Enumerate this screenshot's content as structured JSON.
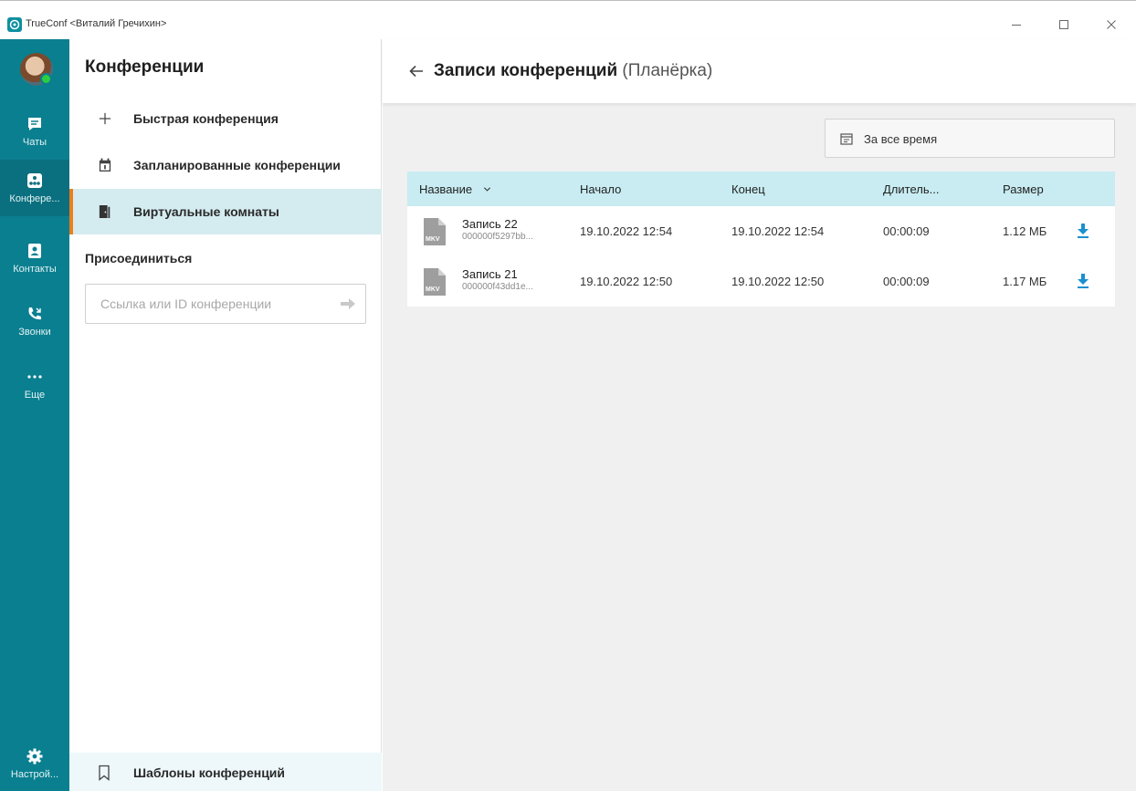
{
  "window": {
    "title": "TrueConf <Виталий Гречихин>"
  },
  "rail": {
    "items": [
      {
        "label": "Чаты",
        "icon": "chat-icon"
      },
      {
        "label": "Конфере...",
        "icon": "conference-icon"
      },
      {
        "label": "Контакты",
        "icon": "contacts-icon"
      },
      {
        "label": "Звонки",
        "icon": "calls-icon"
      },
      {
        "label": "Еще",
        "icon": "more-icon"
      }
    ],
    "settings_label": "Настрой..."
  },
  "panel": {
    "title": "Конференции",
    "menu": [
      {
        "label": "Быстрая конференция",
        "icon": "plus-icon"
      },
      {
        "label": "Запланированные конференции",
        "icon": "calendar-icon"
      },
      {
        "label": "Виртуальные комнаты",
        "icon": "door-icon"
      }
    ],
    "join_title": "Присоединиться",
    "join_placeholder": "Ссылка или ID конференции",
    "templates_label": "Шаблоны конференций"
  },
  "content": {
    "title": "Записи конференций",
    "subtitle": "(Планёрка)",
    "filter_label": "За все время",
    "columns": [
      "Название",
      "Начало",
      "Конец",
      "Длитель...",
      "Размер"
    ],
    "records": [
      {
        "name": "Запись 22",
        "id": "000000f5297bb...",
        "start": "19.10.2022 12:54",
        "end": "19.10.2022 12:54",
        "duration": "00:00:09",
        "size": "1.12 МБ",
        "format": "MKV"
      },
      {
        "name": "Запись 21",
        "id": "000000f43dd1e...",
        "start": "19.10.2022 12:50",
        "end": "19.10.2022 12:50",
        "duration": "00:00:09",
        "size": "1.17 МБ",
        "format": "MKV"
      }
    ]
  },
  "colors": {
    "rail": "#0a7f8f",
    "accent": "#ef7d1a",
    "table_header": "#c8ecf2",
    "download": "#1a8fd0"
  }
}
